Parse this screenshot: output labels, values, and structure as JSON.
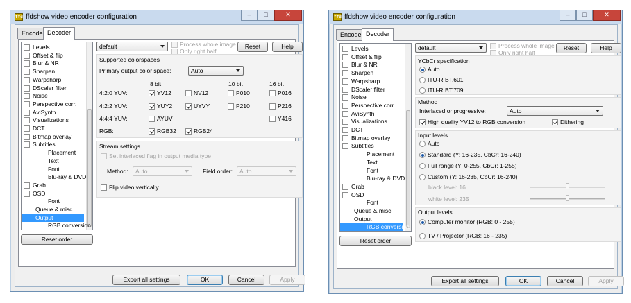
{
  "left": {
    "title": "ffdshow video encoder configuration",
    "tabs": [
      "Encoder",
      "Decoder"
    ],
    "tree": [
      {
        "label": "Levels",
        "check": true,
        "checked": false
      },
      {
        "label": "Offset & flip",
        "check": true,
        "checked": false
      },
      {
        "label": "Blur & NR",
        "check": true,
        "checked": false
      },
      {
        "label": "Sharpen",
        "check": true,
        "checked": false
      },
      {
        "label": "Warpsharp",
        "check": true,
        "checked": false
      },
      {
        "label": "DScaler filter",
        "check": true,
        "checked": false
      },
      {
        "label": "Noise",
        "check": true,
        "checked": false
      },
      {
        "label": "Perspective corr.",
        "check": true,
        "checked": false
      },
      {
        "label": "AviSynth",
        "check": true,
        "checked": false
      },
      {
        "label": "Visualizations",
        "check": true,
        "checked": false
      },
      {
        "label": "DCT",
        "check": true,
        "checked": false
      },
      {
        "label": "Bitmap overlay",
        "check": true,
        "checked": false
      },
      {
        "label": "Subtitles",
        "check": true,
        "checked": false
      },
      {
        "label": "Placement",
        "check": false,
        "indent": 2
      },
      {
        "label": "Text",
        "check": false,
        "indent": 2
      },
      {
        "label": "Font",
        "check": false,
        "indent": 2
      },
      {
        "label": "Blu-ray & DVD",
        "check": false,
        "indent": 2
      },
      {
        "label": "Grab",
        "check": true,
        "checked": false
      },
      {
        "label": "OSD",
        "check": true,
        "checked": false
      },
      {
        "label": "Font",
        "check": false,
        "indent": 2
      },
      {
        "label": "Queue & misc",
        "check": false,
        "indent": 1
      },
      {
        "label": "Output",
        "check": false,
        "indent": 1,
        "selected": true
      },
      {
        "label": "RGB conversion",
        "check": false,
        "indent": 2
      }
    ],
    "reset_order": "Reset order",
    "preset": "default",
    "process_whole": "Process whole image",
    "only_right": "Only right half",
    "reset": "Reset",
    "help": "Help",
    "supported_title": "Supported colorspaces",
    "primary_label": "Primary output color space:",
    "primary_value": "Auto",
    "bit8": "8 bit",
    "bit10": "10 bit",
    "bit16": "16 bit",
    "rows": [
      {
        "label": "4:2:0 YUV:",
        "items": [
          {
            "name": "YV12",
            "on": true
          },
          {
            "name": "NV12",
            "on": false
          },
          {
            "name": "P010",
            "on": false
          },
          {
            "name": "P016",
            "on": false
          }
        ]
      },
      {
        "label": "4:2:2 YUV:",
        "items": [
          {
            "name": "YUY2",
            "on": true
          },
          {
            "name": "UYVY",
            "on": true
          },
          {
            "name": "P210",
            "on": false
          },
          {
            "name": "P216",
            "on": false
          }
        ]
      },
      {
        "label": "4:4:4 YUV:",
        "items": [
          {
            "name": "AYUV",
            "on": false
          },
          {
            "name": "Y416",
            "on": false
          }
        ]
      },
      {
        "label": "RGB:",
        "items": [
          {
            "name": "RGB32",
            "on": true
          },
          {
            "name": "RGB24",
            "on": true
          }
        ]
      }
    ],
    "stream_title": "Stream settings",
    "set_interlaced": "Set interlaced flag in output media type",
    "method_label": "Method:",
    "method_value": "Auto",
    "field_label": "Field order:",
    "field_value": "Auto",
    "flip": "Flip video vertically",
    "export": "Export all settings",
    "ok": "OK",
    "cancel": "Cancel",
    "apply": "Apply"
  },
  "right": {
    "title": "ffdshow video encoder configuration",
    "tabs": [
      "Encoder",
      "Decoder"
    ],
    "tree": [
      {
        "label": "Levels",
        "check": true,
        "checked": false
      },
      {
        "label": "Offset & flip",
        "check": true,
        "checked": false
      },
      {
        "label": "Blur & NR",
        "check": true,
        "checked": false
      },
      {
        "label": "Sharpen",
        "check": true,
        "checked": false
      },
      {
        "label": "Warpsharp",
        "check": true,
        "checked": false
      },
      {
        "label": "DScaler filter",
        "check": true,
        "checked": false
      },
      {
        "label": "Noise",
        "check": true,
        "checked": false
      },
      {
        "label": "Perspective corr.",
        "check": true,
        "checked": false
      },
      {
        "label": "AviSynth",
        "check": true,
        "checked": false
      },
      {
        "label": "Visualizations",
        "check": true,
        "checked": false
      },
      {
        "label": "DCT",
        "check": true,
        "checked": false
      },
      {
        "label": "Bitmap overlay",
        "check": true,
        "checked": false
      },
      {
        "label": "Subtitles",
        "check": true,
        "checked": false
      },
      {
        "label": "Placement",
        "check": false,
        "indent": 2
      },
      {
        "label": "Text",
        "check": false,
        "indent": 2
      },
      {
        "label": "Font",
        "check": false,
        "indent": 2
      },
      {
        "label": "Blu-ray & DVD",
        "check": false,
        "indent": 2
      },
      {
        "label": "Grab",
        "check": true,
        "checked": false
      },
      {
        "label": "OSD",
        "check": true,
        "checked": false
      },
      {
        "label": "Font",
        "check": false,
        "indent": 2
      },
      {
        "label": "Queue & misc",
        "check": false,
        "indent": 1
      },
      {
        "label": "Output",
        "check": false,
        "indent": 1
      },
      {
        "label": "RGB conversion",
        "check": false,
        "indent": 2,
        "selected": true
      }
    ],
    "reset_order": "Reset order",
    "preset": "default",
    "process_whole": "Process whole image",
    "only_right": "Only right half",
    "reset": "Reset",
    "help": "Help",
    "ycbcr_title": "YCbCr specification",
    "ycbcr_auto": "Auto",
    "ycbcr_601": "ITU-R BT.601",
    "ycbcr_709": "ITU-R BT.709",
    "method_title": "Method",
    "interlaced_label": "Interlaced or progressive:",
    "interlaced_value": "Auto",
    "hq": "High quality YV12 to RGB conversion",
    "dithering": "Dithering",
    "input_title": "Input levels",
    "in_auto": "Auto",
    "in_standard": "Standard  (Y: 16-235, CbCr: 16-240)",
    "in_full": "Full range  (Y: 0-255, CbCr: 1-255)",
    "in_custom": "Custom  (Y: 16-235, CbCr: 16-240)",
    "black_level": "black level: 16",
    "white_level": "white level: 235",
    "output_title": "Output levels",
    "out_monitor": "Computer monitor  (RGB: 0 - 255)",
    "out_tv": "TV / Projector  (RGB: 16 - 235)",
    "export": "Export all settings",
    "ok": "OK",
    "cancel": "Cancel",
    "apply": "Apply"
  }
}
